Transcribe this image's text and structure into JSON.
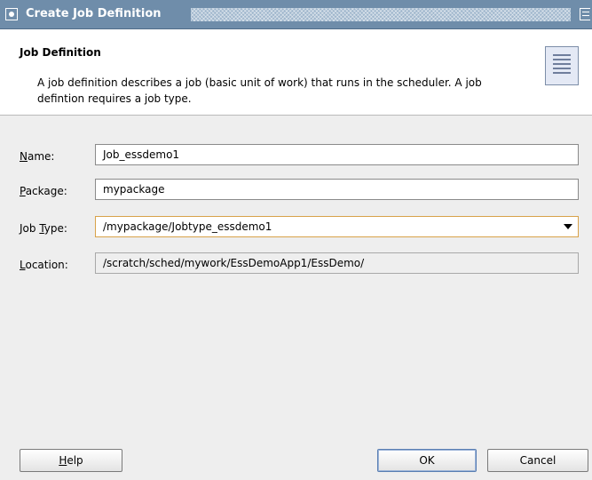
{
  "window": {
    "title": "Create Job Definition"
  },
  "header": {
    "title": "Job Definition",
    "description": "A job definition describes a job (basic unit of work) that runs in the scheduler.  A job defintion requires a job type."
  },
  "form": {
    "name": {
      "label_mnemonic": "N",
      "label_rest": "ame:",
      "value": "Job_essdemo1"
    },
    "package": {
      "label_mnemonic": "P",
      "label_rest": "ackage:",
      "value": "mypackage"
    },
    "job_type": {
      "label_prefix": "Job ",
      "label_mnemonic": "T",
      "label_rest": "ype:",
      "value": "/mypackage/Jobtype_essdemo1"
    },
    "location": {
      "label_mnemonic": "L",
      "label_rest": "ocation:",
      "value": "/scratch/sched/mywork/EssDemoApp1/EssDemo/"
    }
  },
  "buttons": {
    "help": {
      "mnemonic": "H",
      "rest": "elp"
    },
    "ok": "OK",
    "cancel": "Cancel"
  },
  "icons": {
    "window": "window-menu-icon",
    "restore": "restore-icon",
    "header": "document-list-icon"
  },
  "colors": {
    "titlebar": "#6f8daa",
    "focus_border": "#d8a24a"
  }
}
